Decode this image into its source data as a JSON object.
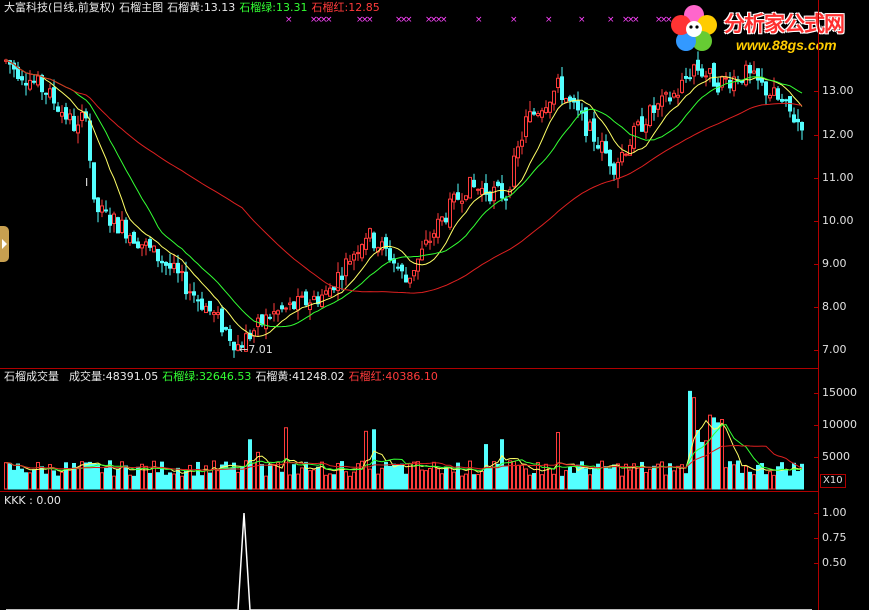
{
  "main_header": {
    "stock": "大富科技(日线,前复权)",
    "indicator": "石榴主图",
    "yellow_label": "石榴黄:",
    "yellow_value": "13.13",
    "green_label": "石榴绿:",
    "green_value": "13.31",
    "red_label": "石榴红:",
    "red_value": "12.85"
  },
  "vol_header": {
    "indicator": "石榴成交量",
    "vol_label": "成交量:",
    "vol_value": "48391.05",
    "green_label": "石榴绿:",
    "green_value": "32646.53",
    "yellow_label": "石榴黄:",
    "yellow_value": "41248.02",
    "red_label": "石榴红:",
    "red_value": "40386.10"
  },
  "kkk_header": {
    "label": "KKK : 0.00"
  },
  "logo": {
    "name": "分析家公式网",
    "url": "www.88gs.com"
  },
  "markers": {
    "low_label": "←7.01",
    "small_mark": "I"
  },
  "price_axis": [
    "13.00",
    "12.00",
    "11.00",
    "10.00",
    "9.00",
    "8.00",
    "7.00"
  ],
  "vol_axis": [
    "15000",
    "10000",
    "5000"
  ],
  "vol_scale": "X10",
  "kkk_axis": [
    "1.00",
    "0.75",
    "0.50"
  ],
  "colors": {
    "up": "#ff3b3b",
    "down": "#54ffff",
    "yellow": "#ffff66",
    "green": "#33ff33",
    "red": "#dd2020",
    "grid": "#b00000",
    "magenta": "#ff44ff"
  }
}
